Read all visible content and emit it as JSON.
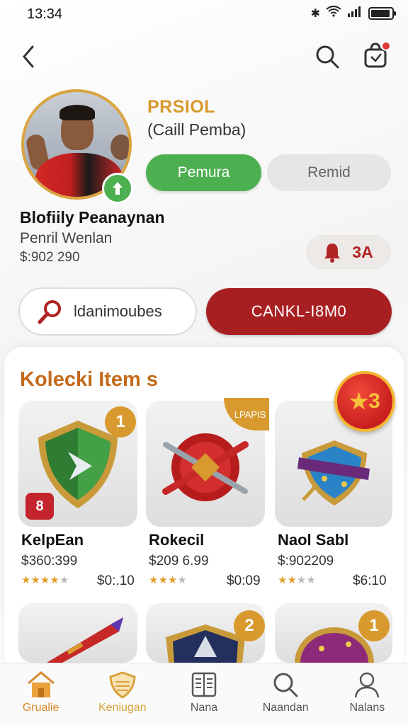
{
  "status_bar": {
    "time": "13:34"
  },
  "header": {
    "back_icon": "chevron-left-icon",
    "search_icon": "search-icon",
    "bag_icon": "shopping-bag-icon"
  },
  "profile": {
    "brand_title": "PRSIOL",
    "brand_subtitle": "(Caill Pemba)",
    "primary_button": "Pemura",
    "secondary_button": "Remid",
    "name": "Blofiily Peanaynan",
    "role": "Penril Wenlan",
    "balance": "$:902 290",
    "notification_count": "3A"
  },
  "actions": {
    "search_label": "ldanimoubes",
    "cancel_button": "CANKL-I8M0"
  },
  "collection": {
    "title": "Kolecki Item s",
    "corner_badge": "3",
    "items": [
      {
        "name": "KelpEan",
        "price": "$360:399",
        "alt_price": "$0:.10",
        "rating": 4,
        "badge": "1",
        "logo": "8"
      },
      {
        "name": "Rokecil",
        "price": "$209 6.99",
        "alt_price": "$0:09",
        "rating": 3,
        "badge": "LPAPIS"
      },
      {
        "name": "Naol Sabl",
        "price": "$:902209",
        "alt_price": "$6:10",
        "rating": 2.5
      },
      {
        "badge": ""
      },
      {
        "badge": "2"
      },
      {
        "badge": "1"
      }
    ]
  },
  "bottom_nav": [
    {
      "label": "Grualie",
      "icon": "home-icon"
    },
    {
      "label": "Keniugan",
      "icon": "shield-icon"
    },
    {
      "label": "Nana",
      "icon": "book-icon"
    },
    {
      "label": "Naandan",
      "icon": "search-icon"
    },
    {
      "label": "Nalans",
      "icon": "user-icon"
    }
  ],
  "colors": {
    "accent_green": "#4caf50",
    "accent_red": "#a81f22",
    "accent_gold": "#d89a2e",
    "section_title": "#c46a1c"
  }
}
